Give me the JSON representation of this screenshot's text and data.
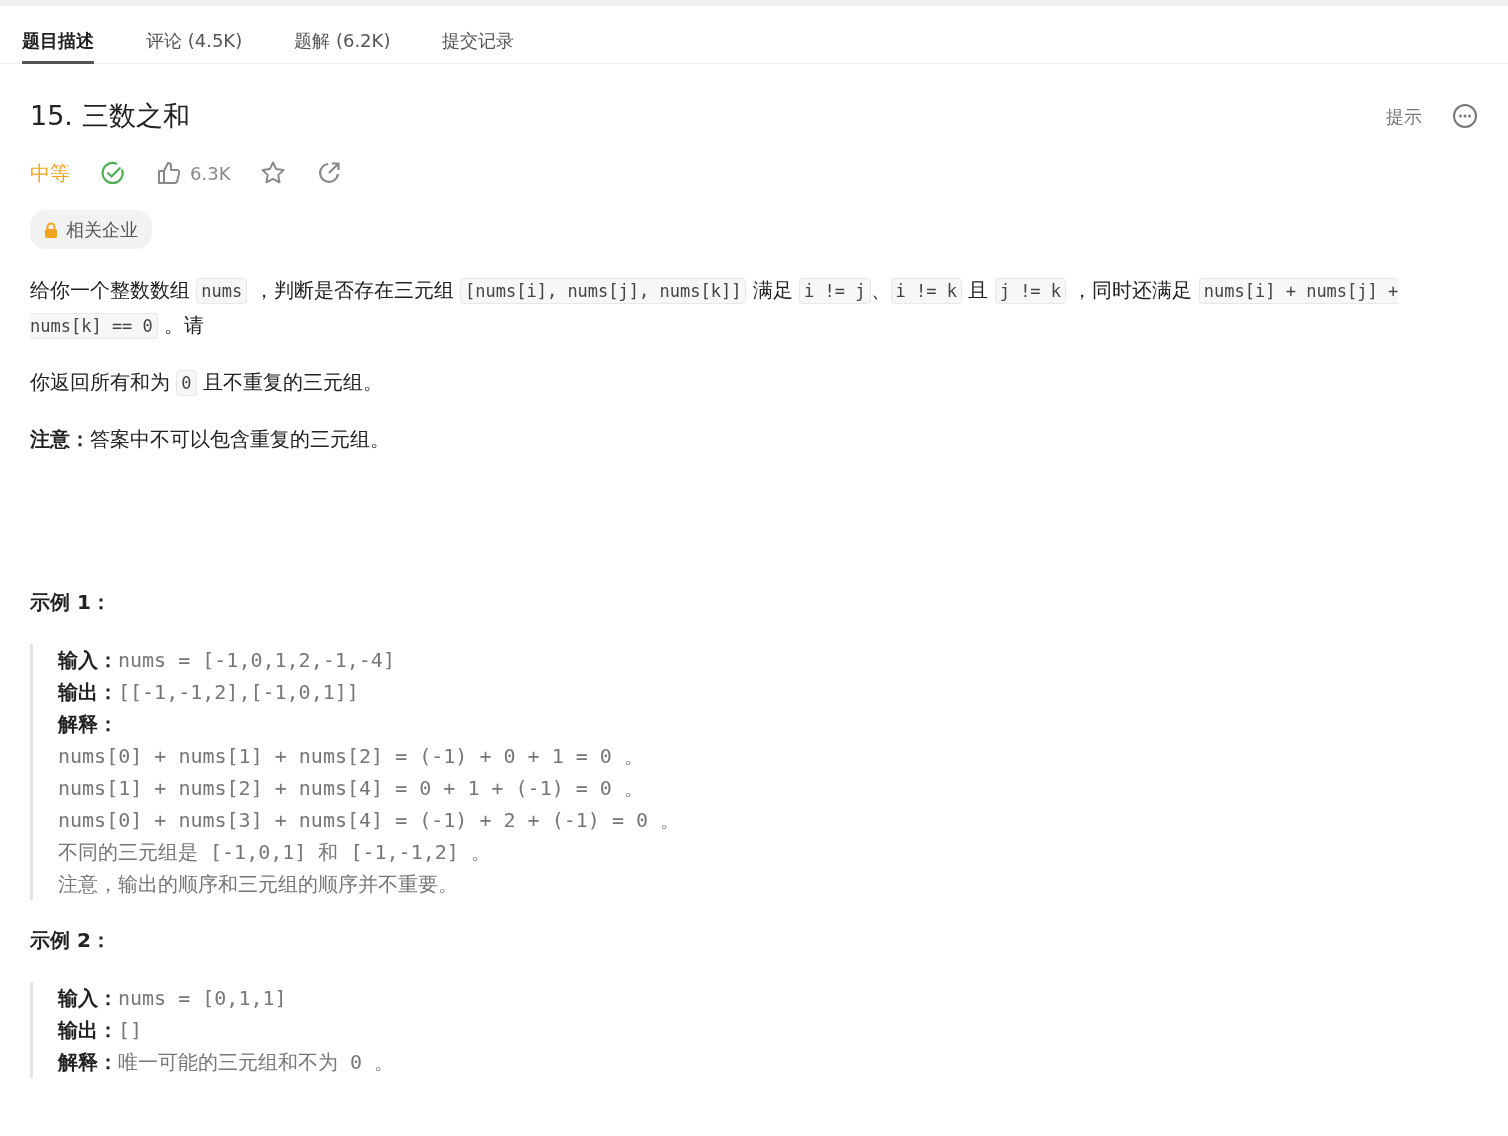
{
  "tabs": [
    {
      "label": "题目描述",
      "selected": true
    },
    {
      "label": "评论 (4.5K)",
      "selected": false
    },
    {
      "label": "题解 (6.2K)",
      "selected": false
    },
    {
      "label": "提交记录",
      "selected": false
    }
  ],
  "problem": {
    "title": "15. 三数之和",
    "hint": "提示",
    "difficulty": "中等",
    "solved": true,
    "likes": "6.3K",
    "company_tag": "相关企业"
  },
  "description": [
    [
      {
        "kind": "text",
        "text": "给你一个整数数组 "
      },
      {
        "kind": "code",
        "text": "nums"
      },
      {
        "kind": "text",
        "text": " ，判断是否存在三元组 "
      },
      {
        "kind": "code",
        "text": "[nums[i], nums[j], nums[k]]"
      },
      {
        "kind": "text",
        "text": " 满足 "
      },
      {
        "kind": "code",
        "text": "i != j"
      },
      {
        "kind": "text",
        "text": "、"
      },
      {
        "kind": "code",
        "text": "i != k"
      },
      {
        "kind": "text",
        "text": " 且 "
      },
      {
        "kind": "code",
        "text": "j != k"
      },
      {
        "kind": "text",
        "text": " ，同时还满足 "
      },
      {
        "kind": "code",
        "text": "nums[i] + nums[j] + nums[k] == 0"
      },
      {
        "kind": "text",
        "text": " 。请"
      }
    ],
    [
      {
        "kind": "text",
        "text": "你返回所有和为 "
      },
      {
        "kind": "code",
        "text": "0"
      },
      {
        "kind": "text",
        "text": " 且不重复的三元组。"
      }
    ],
    [
      {
        "kind": "text",
        "text": "**注意：**答案中不可以包含重复的三元组。"
      }
    ]
  ],
  "examples": [
    {
      "title": "示例 1：",
      "lines": [
        {
          "label": "输入：",
          "text": "nums = [-1,0,1,2,-1,-4]"
        },
        {
          "label": "输出：",
          "text": "[[-1,-1,2],[-1,0,1]]"
        },
        {
          "label": "解释："
        },
        {
          "text": "nums[0] + nums[1] + nums[2] = (-1) + 0 + 1 = 0 。"
        },
        {
          "text": "nums[1] + nums[2] + nums[4] = 0 + 1 + (-1) = 0 。"
        },
        {
          "text": "nums[0] + nums[3] + nums[4] = (-1) + 2 + (-1) = 0 。"
        },
        {
          "text": "不同的三元组是 [-1,0,1] 和 [-1,-1,2] 。"
        },
        {
          "text": "注意，输出的顺序和三元组的顺序并不重要。"
        }
      ]
    },
    {
      "title": "示例 2：",
      "lines": [
        {
          "label": "输入：",
          "text": "nums = [0,1,1]"
        },
        {
          "label": "输出：",
          "text": "[]"
        },
        {
          "label": "解释：",
          "text": "唯一可能的三元组和不为 0 。"
        }
      ]
    }
  ]
}
